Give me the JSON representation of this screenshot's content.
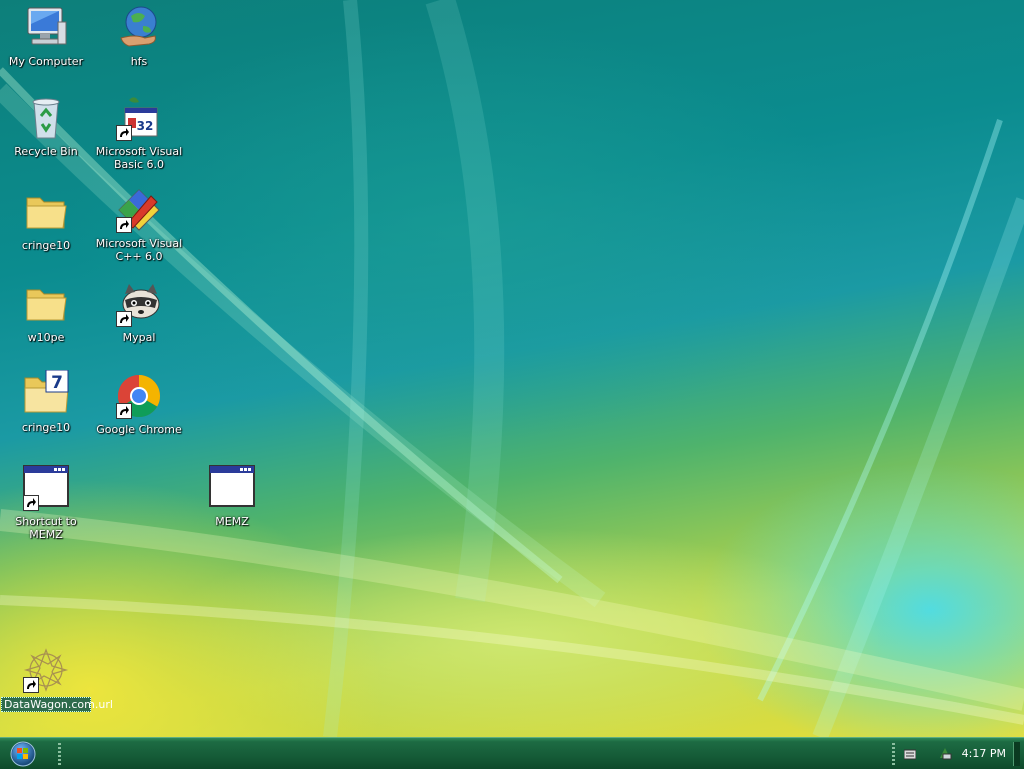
{
  "desktop": {
    "icons": [
      {
        "label": "My Computer",
        "icon": "computer-icon"
      },
      {
        "label": "hfs",
        "icon": "globe-hand-icon"
      },
      {
        "label": "Recycle Bin",
        "icon": "recycle-bin-icon"
      },
      {
        "label": "Microsoft Visual Basic 6.0",
        "icon": "vb6-icon",
        "shortcut": true
      },
      {
        "label": "cringe10",
        "icon": "folder-icon"
      },
      {
        "label": "Microsoft Visual C++ 6.0",
        "icon": "vc6-icon",
        "shortcut": true
      },
      {
        "label": "w10pe",
        "icon": "folder-icon"
      },
      {
        "label": "Mypal",
        "icon": "raccoon-icon",
        "shortcut": true
      },
      {
        "label": "cringe10",
        "icon": "folder-7-icon"
      },
      {
        "label": "Google Chrome",
        "icon": "chrome-icon",
        "shortcut": true
      },
      {
        "label": "Shortcut to MEMZ",
        "icon": "window-app-icon",
        "shortcut": true
      },
      {
        "label": "MEMZ",
        "icon": "window-app-icon"
      },
      {
        "label": "DataWagon.com.url",
        "icon": "datawagon-icon",
        "shortcut": true,
        "selected": true
      }
    ]
  },
  "taskbar": {
    "start_icon": "windows-orb-icon",
    "tray_icons": [
      "keyboard-icon",
      "network-icon"
    ],
    "clock": "4:17 PM"
  },
  "colors": {
    "taskbar": "#155b37",
    "selection": "#2f6b4c"
  }
}
